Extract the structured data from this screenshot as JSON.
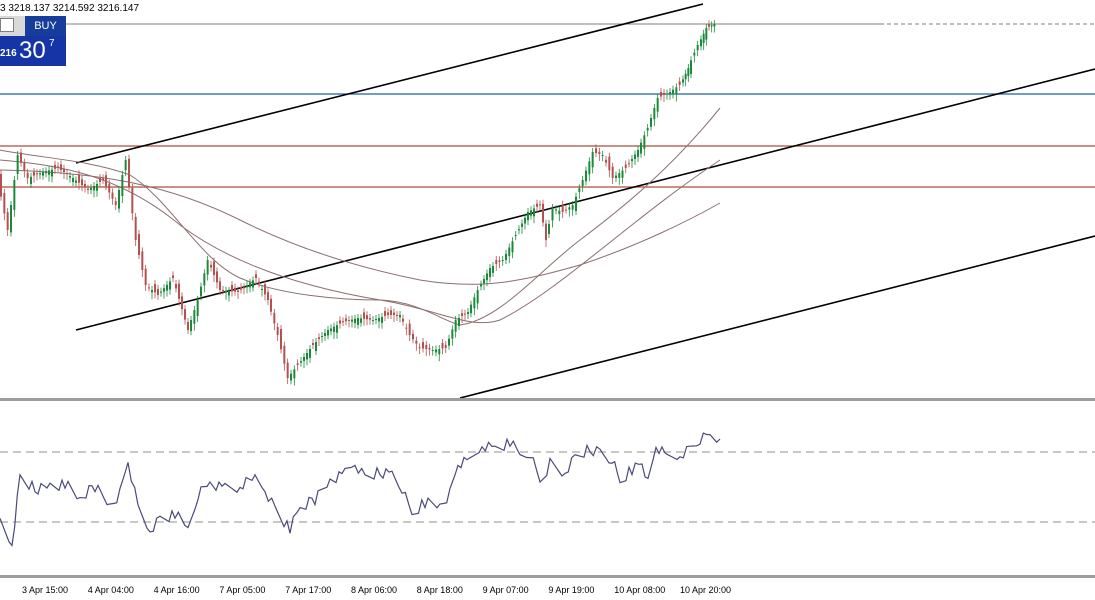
{
  "toolbar": {
    "ohlc_text": "3 3218.137 3214.592 3216.147",
    "buy_label": "BUY",
    "price_small": "216",
    "price_big": "30",
    "price_sup": "7"
  },
  "chart_data": [
    {
      "type": "candlestick",
      "x_tick_labels": [
        "3 Apr 15:00",
        "4 Apr 04:00",
        "4 Apr 16:00",
        "7 Apr 05:00",
        "7 Apr 17:00",
        "8 Apr 06:00",
        "8 Apr 18:00",
        "9 Apr 07:00",
        "9 Apr 19:00",
        "10 Apr 08:00",
        "10 Apr 20:00"
      ],
      "last_close": 3216.147,
      "approx_range": [
        2955,
        3222
      ],
      "horizontal_levels": [
        {
          "kind": "current-price",
          "value": 3216,
          "color": "#7f7f7f"
        },
        {
          "kind": "support-resistance",
          "value": 3166,
          "color": "#1f5fa8"
        },
        {
          "kind": "support-resistance",
          "value": 3131,
          "color": "#b04a3a"
        },
        {
          "kind": "support-resistance",
          "value": 3103,
          "color": "#b04a3a"
        }
      ],
      "trend_channel": "ascending",
      "moving_averages": 3,
      "grid": false
    },
    {
      "type": "line",
      "indicator": "RSI",
      "levels": [
        70,
        30
      ],
      "grid": false
    }
  ]
}
